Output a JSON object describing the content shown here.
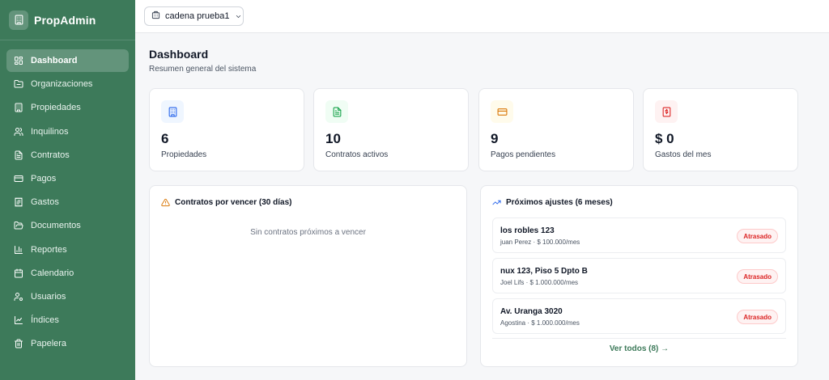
{
  "brand": {
    "name": "PropAdmin",
    "icon": "building-icon"
  },
  "sidebar": {
    "items": [
      {
        "label": "Dashboard",
        "icon": "layout-dashboard-icon",
        "active": true
      },
      {
        "label": "Organizaciones",
        "icon": "folder-icon"
      },
      {
        "label": "Propiedades",
        "icon": "building-icon"
      },
      {
        "label": "Inquilinos",
        "icon": "users-icon"
      },
      {
        "label": "Contratos",
        "icon": "file-text-icon"
      },
      {
        "label": "Pagos",
        "icon": "credit-card-icon"
      },
      {
        "label": "Gastos",
        "icon": "receipt-icon"
      },
      {
        "label": "Documentos",
        "icon": "folder-open-icon"
      },
      {
        "label": "Reportes",
        "icon": "bar-chart-icon"
      },
      {
        "label": "Calendario",
        "icon": "calendar-icon"
      },
      {
        "label": "Usuarios",
        "icon": "user-cog-icon"
      },
      {
        "label": "Índices",
        "icon": "trending-up-icon"
      },
      {
        "label": "Papelera",
        "icon": "trash-icon"
      }
    ]
  },
  "topbar": {
    "org_selector": "cadena prueba1"
  },
  "header": {
    "title": "Dashboard",
    "subtitle": "Resumen general del sistema"
  },
  "stats": [
    {
      "value": "6",
      "label": "Propiedades",
      "icon": "building-icon",
      "color": "#2563eb",
      "bg": "#eff6ff"
    },
    {
      "value": "10",
      "label": "Contratos activos",
      "icon": "file-text-icon",
      "color": "#16a34a",
      "bg": "#f0fdf4"
    },
    {
      "value": "9",
      "label": "Pagos pendientes",
      "icon": "credit-card-icon",
      "color": "#d97706",
      "bg": "#fffbeb"
    },
    {
      "value": "$ 0",
      "label": "Gastos del mes",
      "icon": "receipt-icon",
      "color": "#dc2626",
      "bg": "#fef2f2"
    }
  ],
  "expiring": {
    "title": "Contratos por vencer (30 días)",
    "empty": "Sin contratos próximos a vencer",
    "icon_color": "#d97706"
  },
  "adjustments": {
    "title": "Próximos ajustes (6 meses)",
    "icon_color": "#2563eb",
    "items": [
      {
        "address": "los robles 123",
        "detail": "juan Perez · $ 100.000/mes",
        "status": "Atrasado"
      },
      {
        "address": "nux 123, Piso 5 Dpto B",
        "detail": "Joel Lifs · $ 1.000.000/mes",
        "status": "Atrasado"
      },
      {
        "address": "Av. Uranga 3020",
        "detail": "Agostina · $ 1.000.000/mes",
        "status": "Atrasado"
      }
    ],
    "see_all": "Ver todos (8) →"
  },
  "colors": {
    "sidebar": "#3d7a5a",
    "accent": "#3d7a5a",
    "danger": "#dc2626"
  }
}
